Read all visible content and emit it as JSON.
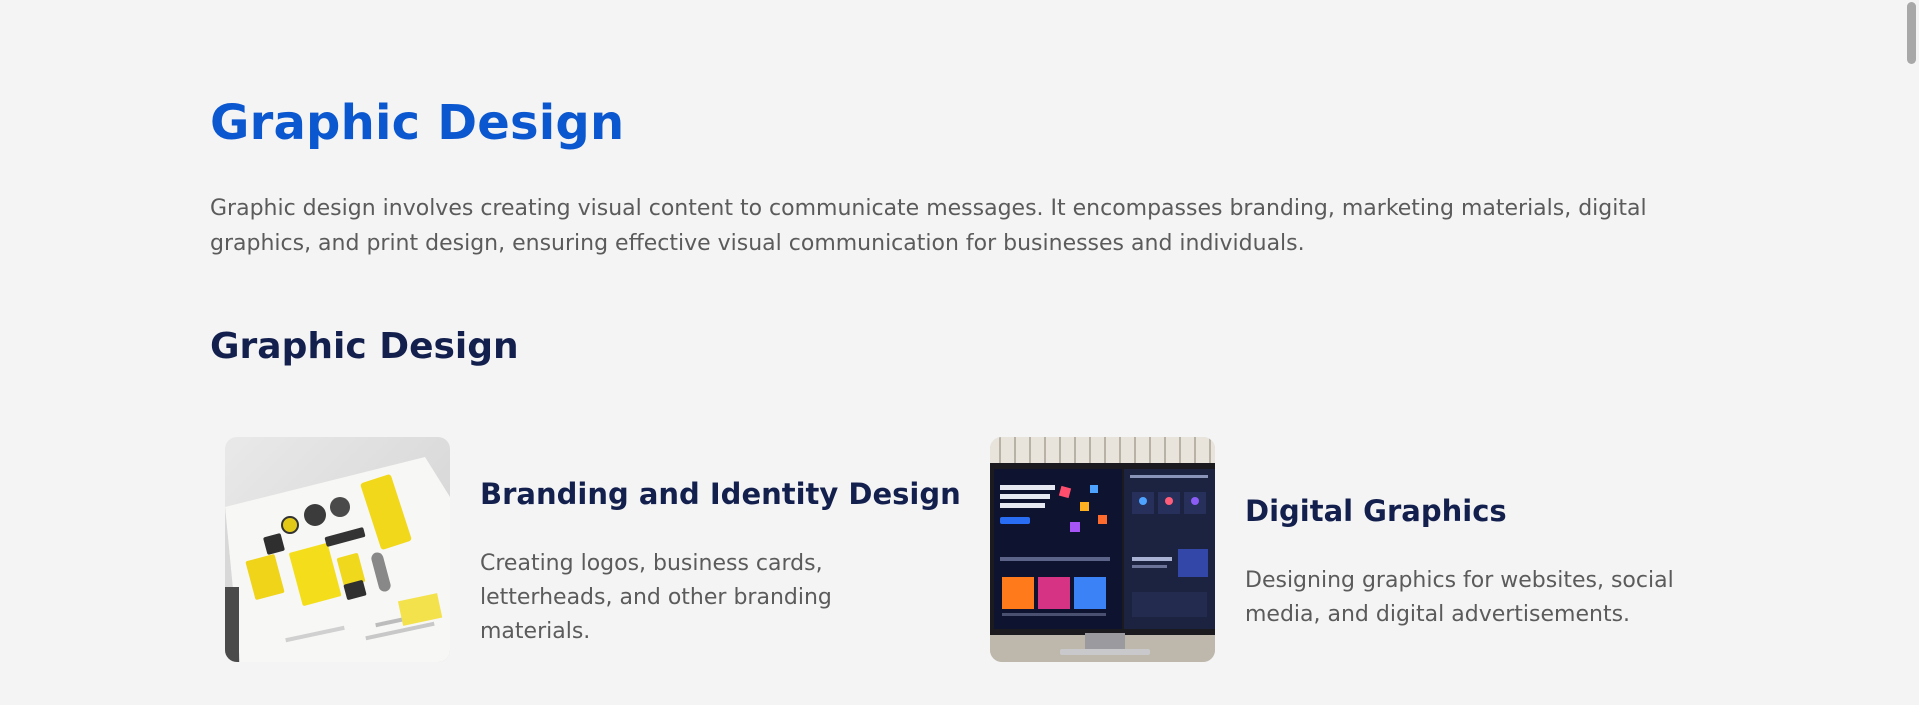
{
  "header": {
    "title": "Graphic Design",
    "intro": "Graphic design involves creating visual content to communicate messages. It encompasses branding, marketing materials, digital graphics, and print design, ensuring effective visual communication for businesses and individuals."
  },
  "section": {
    "title": "Graphic Design",
    "cards": [
      {
        "title": "Branding and Identity Design",
        "description": "Creating logos, business cards, letterheads, and other branding materials.",
        "image_icon": "branding-photo"
      },
      {
        "title": "Digital Graphics",
        "description": "Designing graphics for websites, social media, and digital advertisements.",
        "image_icon": "monitor-photo"
      }
    ]
  },
  "colors": {
    "accent": "#0b57d0",
    "heading": "#13204e",
    "body_text": "#5b5b5b",
    "background": "#f4f4f4"
  }
}
